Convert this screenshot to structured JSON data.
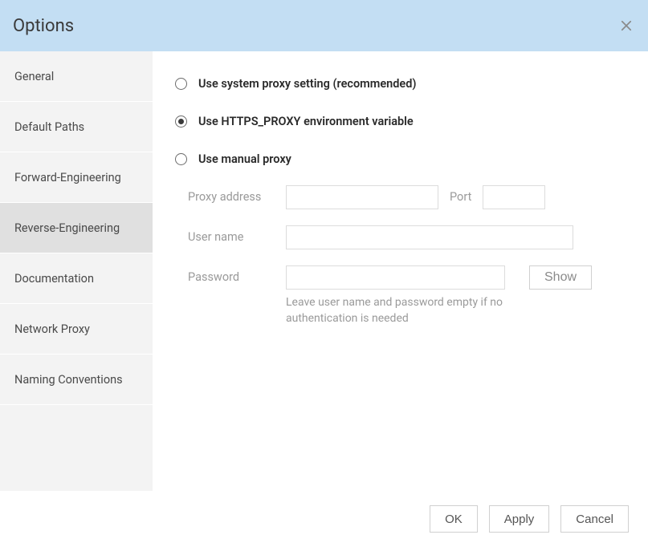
{
  "dialog": {
    "title": "Options"
  },
  "sidebar": {
    "items": [
      {
        "label": "General",
        "selected": false
      },
      {
        "label": "Default Paths",
        "selected": false
      },
      {
        "label": "Forward-Engineering",
        "selected": false
      },
      {
        "label": "Reverse-Engineering",
        "selected": true
      },
      {
        "label": "Documentation",
        "selected": false
      },
      {
        "label": "Network Proxy",
        "selected": false
      },
      {
        "label": "Naming Conventions",
        "selected": false
      }
    ]
  },
  "proxy": {
    "options": [
      {
        "id": "system",
        "label": "Use system proxy setting (recommended)",
        "checked": false
      },
      {
        "id": "env",
        "label": "Use HTTPS_PROXY environment variable",
        "checked": true
      },
      {
        "id": "manual",
        "label": "Use manual proxy",
        "checked": false
      }
    ],
    "address_label": "Proxy address",
    "address_value": "",
    "port_label": "Port",
    "port_value": "",
    "user_label": "User name",
    "user_value": "",
    "password_label": "Password",
    "password_value": "",
    "show_button": "Show",
    "hint": "Leave user name and password empty if no authentication is needed"
  },
  "footer": {
    "ok": "OK",
    "apply": "Apply",
    "cancel": "Cancel"
  }
}
